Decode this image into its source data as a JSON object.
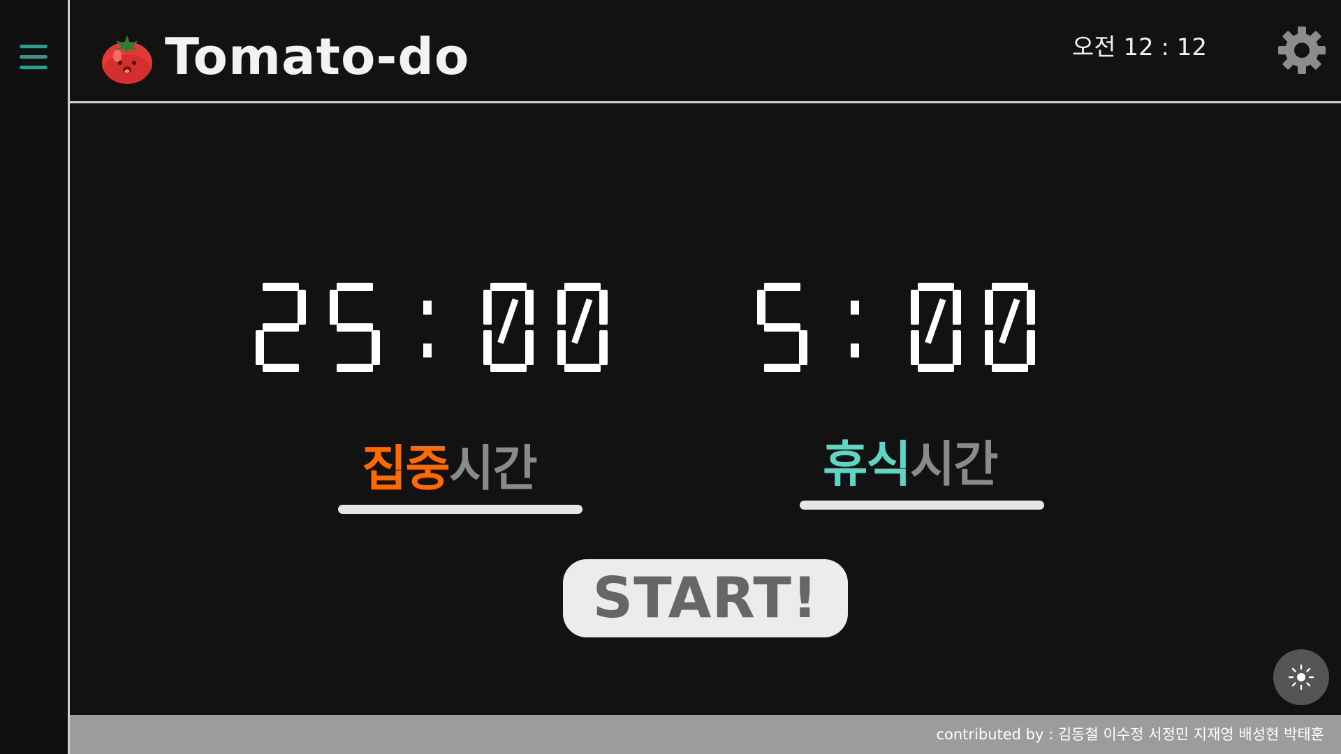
{
  "app": {
    "title": "Tomato-do"
  },
  "header": {
    "clock": "오전 12 : 12"
  },
  "icons": {
    "menu": "hamburger-menu-icon",
    "logo": "tomato-icon",
    "settings": "gear-icon",
    "theme": "sun-icon"
  },
  "timers": {
    "focus": {
      "display": "25:00",
      "label_accent": "집중",
      "label_rest": "시간"
    },
    "break": {
      "display": "5:00",
      "label_accent": "휴식",
      "label_rest": "시간"
    }
  },
  "actions": {
    "start_label": "START!"
  },
  "footer": {
    "credits": "contributed by : 김동철 이수정 서정민 지재영 배성현 박태훈"
  },
  "colors": {
    "background": "#121212",
    "focus_accent": "#ff6a00",
    "break_accent": "#5fd6c4",
    "menu_icon": "#2a9d8f",
    "muted_label": "#8a8a8a",
    "start_button_bg": "#ececec",
    "footer_bg": "#9c9c9c"
  }
}
